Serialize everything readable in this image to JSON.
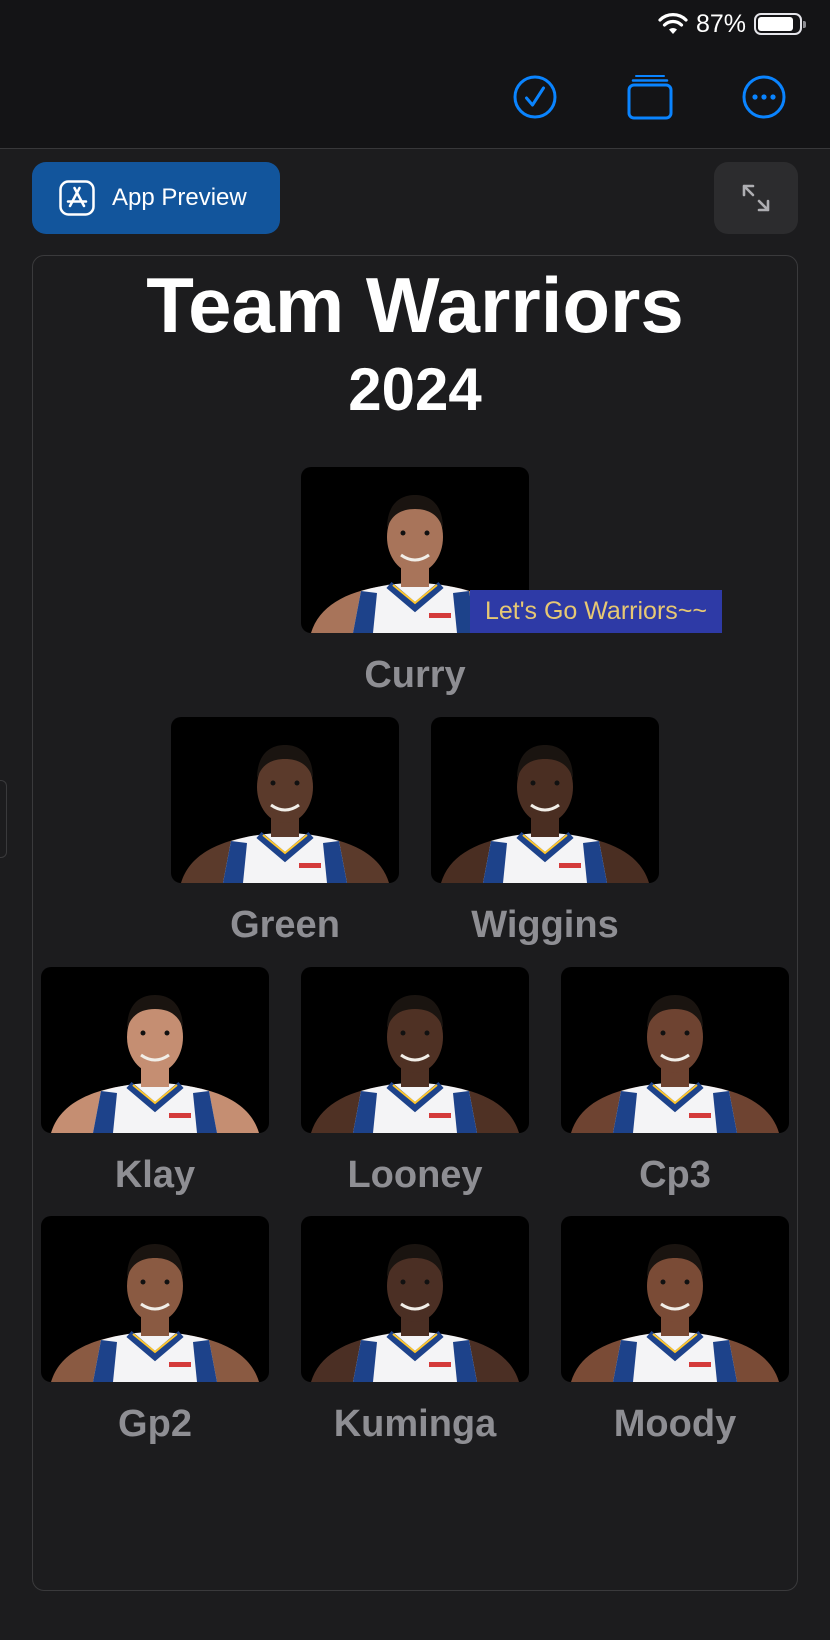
{
  "status_bar": {
    "battery_text": "87%",
    "battery_level": 0.87
  },
  "toolbar": {
    "icons": [
      "checkmark-circle-icon",
      "stack-icon",
      "ellipsis-circle-icon"
    ]
  },
  "preview": {
    "app_preview_label": "App Preview"
  },
  "header": {
    "title": "Team Warriors",
    "year": "2024"
  },
  "banner_text": "Let's Go Warriors~~",
  "players": {
    "row1": [
      {
        "name": "Curry",
        "skin": "#a8745a"
      }
    ],
    "row2": [
      {
        "name": "Green",
        "skin": "#5b3a2b"
      },
      {
        "name": "Wiggins",
        "skin": "#4a2e22"
      }
    ],
    "row3": [
      {
        "name": "Klay",
        "skin": "#c58e72"
      },
      {
        "name": "Looney",
        "skin": "#4f3124"
      },
      {
        "name": "Cp3",
        "skin": "#6e4331"
      }
    ],
    "row4": [
      {
        "name": "Gp2",
        "skin": "#8a5a42"
      },
      {
        "name": "Kuminga",
        "skin": "#4b2f24"
      },
      {
        "name": "Moody",
        "skin": "#7a4b36"
      }
    ]
  },
  "colors": {
    "accent": "#0a84ff",
    "preview_button": "#12559c",
    "banner_bg": "#2e3aa6",
    "banner_text": "#e7c873",
    "jersey_blue": "#1d428a",
    "jersey_white": "#f4f4f6"
  }
}
